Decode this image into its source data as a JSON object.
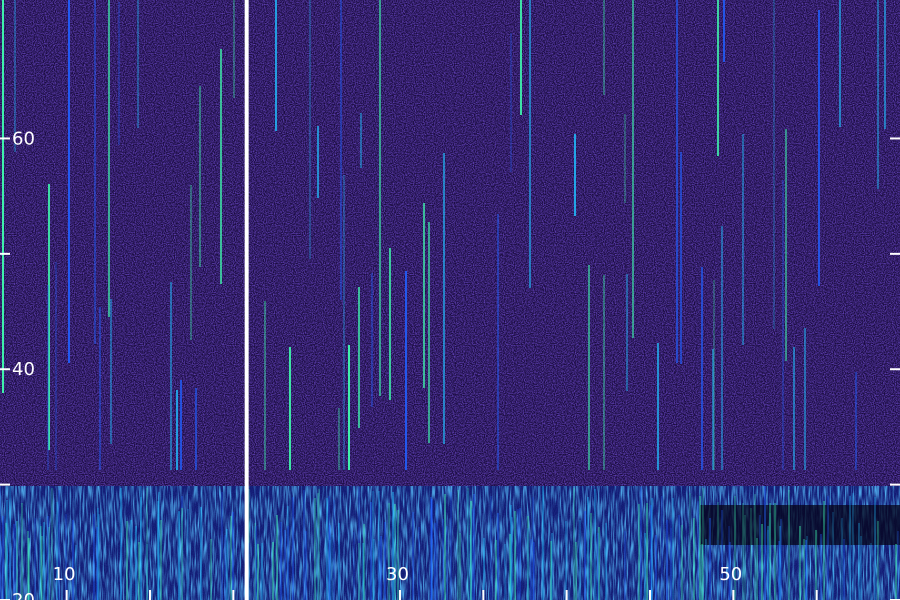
{
  "chart_data": {
    "type": "heatmap",
    "title": "",
    "xlabel": "",
    "ylabel": "",
    "x_range": [
      6,
      60
    ],
    "y_range": [
      20,
      72
    ],
    "x_tick_labels": [
      {
        "value": 10,
        "label": "10"
      },
      {
        "value": 30,
        "label": "30"
      },
      {
        "value": 50,
        "label": "50"
      }
    ],
    "x_minor_ticks": [
      10,
      15,
      20,
      30,
      35,
      40,
      45,
      50,
      55
    ],
    "y_tick_labels": [
      {
        "value": 20,
        "label": "20"
      },
      {
        "value": 40,
        "label": "40"
      },
      {
        "value": 60,
        "label": "60"
      }
    ],
    "y_minor_ticks": [
      20,
      30,
      40,
      50,
      60
    ],
    "divider_x": 20.8,
    "background_color": "#1a0c3f",
    "colormap": [
      "#1a0c3f",
      "#2a0f8f",
      "#3a1fd0",
      "#2060ff",
      "#20c0ff",
      "#40ffb0"
    ],
    "grid": false,
    "legend": "none"
  }
}
